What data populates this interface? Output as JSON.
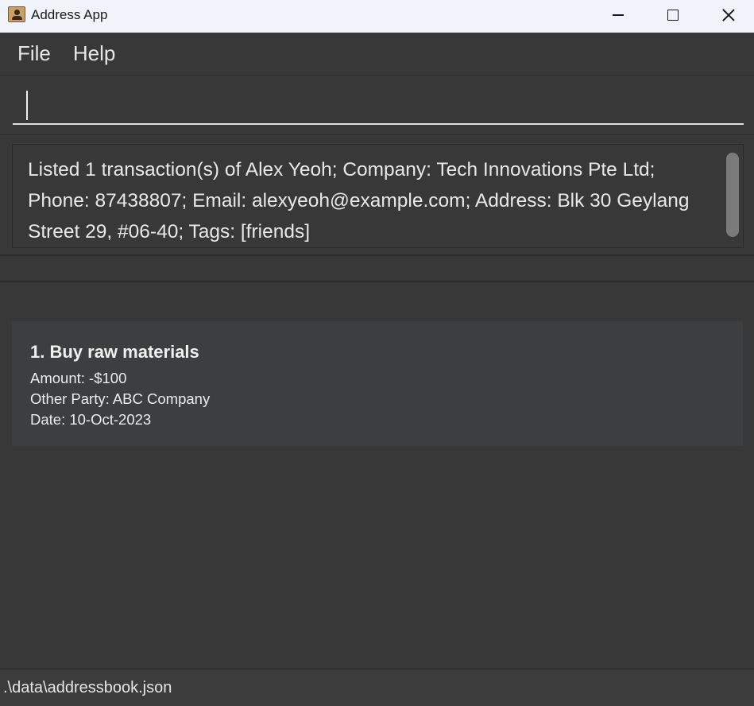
{
  "window": {
    "title": "Address App",
    "icon": "address-book-icon"
  },
  "menu": {
    "items": [
      {
        "label": "File"
      },
      {
        "label": "Help"
      }
    ]
  },
  "command": {
    "value": "",
    "placeholder": ""
  },
  "result": {
    "line1": "Listed 1 transaction(s) of Alex Yeoh; Company: Tech Innovations Pte Ltd;",
    "line2": "Phone: 87438807; Email: alexyeoh@example.com; Address: Blk 30 Geylang",
    "line3": "Street 29, #06-40; Tags: [friends]"
  },
  "transactions": [
    {
      "title": "1. Buy raw materials",
      "amount": "Amount: -$100",
      "other_party": "Other Party: ABC Company",
      "date": "Date: 10-Oct-2023"
    }
  ],
  "status": {
    "path": ".\\data\\addressbook.json"
  },
  "colors": {
    "background": "#383838",
    "titlebar": "#f0f3f9",
    "card": "#3c3e3f",
    "text": "#e8e8e8"
  }
}
